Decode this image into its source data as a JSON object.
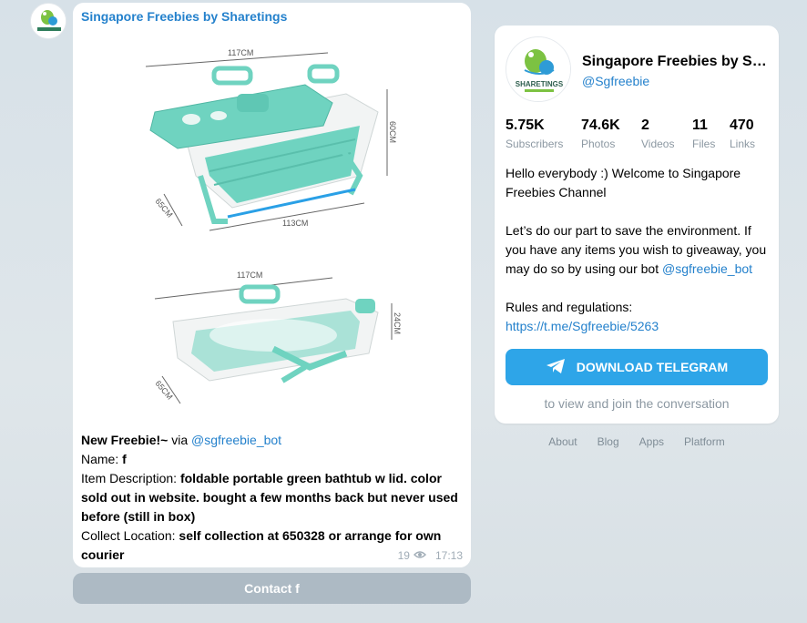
{
  "message": {
    "author": "Singapore Freebies by Sharetings",
    "header": "New Freebie!~",
    "via": "via",
    "via_link": "@sgfreebie_bot",
    "name_label": "Name:",
    "name_value": "f",
    "desc_label": "Item Description:",
    "desc_value": "foldable portable green bathtub w lid. color sold out in website. bought a few months back but never used before (still in box)",
    "location_label": "Collect Location:",
    "location_value": "self collection at 650328 or arrange for own courier",
    "views": "19",
    "time": "17:13",
    "contact_button": "Contact f"
  },
  "photo": {
    "dims_top": {
      "width": "117CM",
      "height": "60CM",
      "depth": "65CM",
      "base": "113CM"
    },
    "dims_bottom": {
      "width": "117CM",
      "height": "24CM",
      "depth": "65CM"
    }
  },
  "card": {
    "title": "Singapore Freebies by Sharetings",
    "handle": "@Sgfreebie",
    "logo_text": "SHARETINGS",
    "stats": [
      {
        "num": "5.75K",
        "label": "Subscribers"
      },
      {
        "num": "74.6K",
        "label": "Photos"
      },
      {
        "num": "2",
        "label": "Videos"
      },
      {
        "num": "11",
        "label": "Files"
      },
      {
        "num": "470",
        "label": "Links"
      }
    ],
    "desc_1": "Hello everybody :) Welcome to Singapore Freebies Channel",
    "desc_2": "Let’s do our part to save the environment. If you have any items you wish to giveaway, you may do so by using our bot",
    "desc_2_link": "@sgfreebie_bot",
    "rules_label": "Rules and regulations:",
    "rules_link": "https://t.me/Sgfreebie/5263",
    "download_button": "DOWNLOAD TELEGRAM",
    "join_text": "to view and join the conversation"
  },
  "footer": [
    "About",
    "Blog",
    "Apps",
    "Platform"
  ],
  "colors": {
    "accent": "#2481cc",
    "download_button": "#2ea5e8",
    "contact_button": "#adbac4",
    "tub_green": "#6fd3c0"
  }
}
